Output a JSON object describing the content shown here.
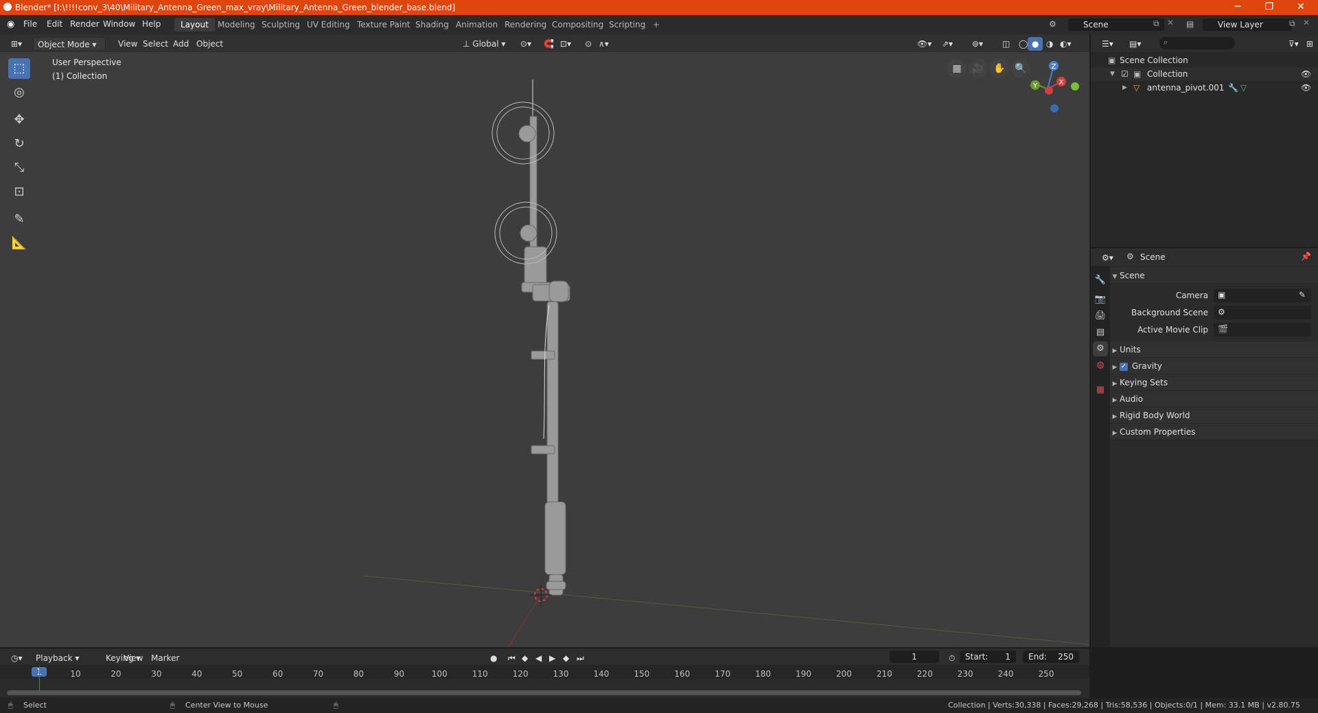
{
  "window": {
    "title": "Blender* [I:\\!!!!conv_3\\40\\Military_Antenna_Green_max_vray\\Military_Antenna_Green_blender_base.blend]",
    "min": "─",
    "max": "❐",
    "close": "✕"
  },
  "menu": [
    "File",
    "Edit",
    "Render",
    "Window",
    "Help"
  ],
  "workspaces": [
    "Layout",
    "Modeling",
    "Sculpting",
    "UV Editing",
    "Texture Paint",
    "Shading",
    "Animation",
    "Rendering",
    "Compositing",
    "Scripting"
  ],
  "workspace_add": "+",
  "scene_field": "Scene",
  "view_layer_field": "View Layer",
  "viewport": {
    "mode": "Object Mode",
    "menus": [
      "View",
      "Select",
      "Add",
      "Object"
    ],
    "orientation": "Global",
    "overlay_text_1": "User Perspective",
    "overlay_text_2": "(1) Collection",
    "gizmo": {
      "z": "Z",
      "y": "Y",
      "x": "X"
    }
  },
  "outliner": {
    "search_placeholder": "",
    "scene_collection": "Scene Collection",
    "collection": "Collection",
    "object": "antenna_pivot.001"
  },
  "properties": {
    "header": "Scene",
    "panel_title": "Scene",
    "camera_label": "Camera",
    "background_scene_label": "Background Scene",
    "active_movie_clip_label": "Active Movie Clip",
    "panels": [
      "Units",
      "Gravity",
      "Keying Sets",
      "Audio",
      "Rigid Body World",
      "Custom Properties"
    ]
  },
  "timeline": {
    "menus": [
      "Playback",
      "Keying",
      "View",
      "Marker"
    ],
    "current_frame": "1",
    "start_label": "Start:",
    "start_value": "1",
    "end_label": "End:",
    "end_value": "250",
    "ticks": [
      "1",
      "10",
      "20",
      "30",
      "40",
      "50",
      "60",
      "70",
      "80",
      "90",
      "100",
      "110",
      "120",
      "130",
      "140",
      "150",
      "160",
      "170",
      "180",
      "190",
      "200",
      "210",
      "220",
      "230",
      "240",
      "250"
    ]
  },
  "status": {
    "select": "Select",
    "center_view": "Center View to Mouse",
    "stats": "Collection | Verts:30,338 | Faces:29,268 | Tris:58,536 | Objects:0/1 | Mem: 33.1 MB | v2.80.75"
  },
  "colors": {
    "accent": "#4772b3",
    "titlebar": "#e0450f",
    "viewport_bg": "#3d3d3d"
  }
}
